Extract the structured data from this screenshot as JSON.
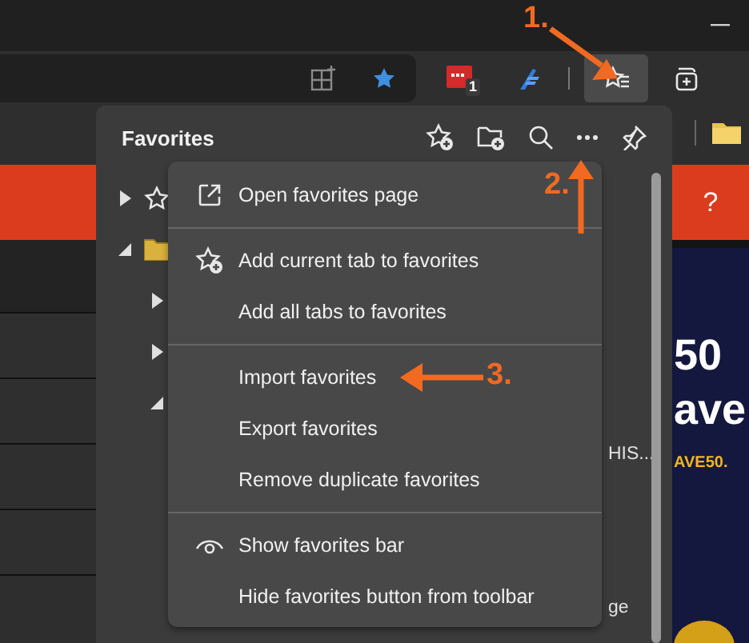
{
  "toolbar": {
    "extension_badge": "1",
    "favorites_button": {
      "selected": true
    }
  },
  "page": {
    "help": "?",
    "ad_lines": [
      {
        "kind": "big",
        "text": "50"
      },
      {
        "kind": "big",
        "text": "ave"
      },
      {
        "kind": "code",
        "text": "AVE50."
      }
    ]
  },
  "favorites_panel": {
    "title": "Favorites",
    "tree": [
      {
        "kind": "favorite",
        "expanded": false
      },
      {
        "kind": "folder",
        "expanded": true,
        "children": [
          {
            "expanded": false
          },
          {
            "expanded": false
          },
          {
            "expanded": true,
            "children": [
              {
                "label": "HIS..."
              },
              {
                "label": "ge"
              }
            ]
          }
        ]
      }
    ]
  },
  "menu": [
    {
      "kind": "item",
      "label": "Open favorites page"
    },
    {
      "kind": "divider"
    },
    {
      "kind": "item",
      "label": "Add current tab to favorites"
    },
    {
      "kind": "item",
      "label": "Add all tabs to favorites"
    },
    {
      "kind": "divider"
    },
    {
      "kind": "item",
      "label": "Import favorites"
    },
    {
      "kind": "item",
      "label": "Export favorites"
    },
    {
      "kind": "item",
      "label": "Remove duplicate favorites"
    },
    {
      "kind": "divider"
    },
    {
      "kind": "item",
      "label": "Show favorites bar"
    },
    {
      "kind": "item",
      "label": "Hide favorites button from toolbar"
    }
  ],
  "annotations": [
    {
      "label": "1."
    },
    {
      "label": "2."
    },
    {
      "label": "3."
    }
  ]
}
